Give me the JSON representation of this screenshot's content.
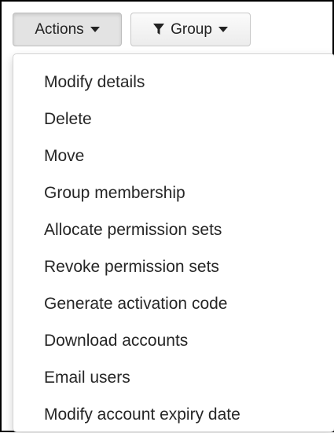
{
  "toolbar": {
    "actions_label": "Actions",
    "group_label": "Group"
  },
  "actions_menu": {
    "items": [
      {
        "label": "Modify details"
      },
      {
        "label": "Delete"
      },
      {
        "label": "Move"
      },
      {
        "label": "Group membership"
      },
      {
        "label": "Allocate permission sets"
      },
      {
        "label": "Revoke permission sets"
      },
      {
        "label": "Generate activation code"
      },
      {
        "label": "Download accounts"
      },
      {
        "label": "Email users"
      },
      {
        "label": "Modify account expiry date"
      }
    ]
  },
  "icons": {
    "filter": "filter-icon",
    "caret": "caret-down-icon"
  },
  "colors": {
    "text": "#262626",
    "border": "#000000"
  }
}
